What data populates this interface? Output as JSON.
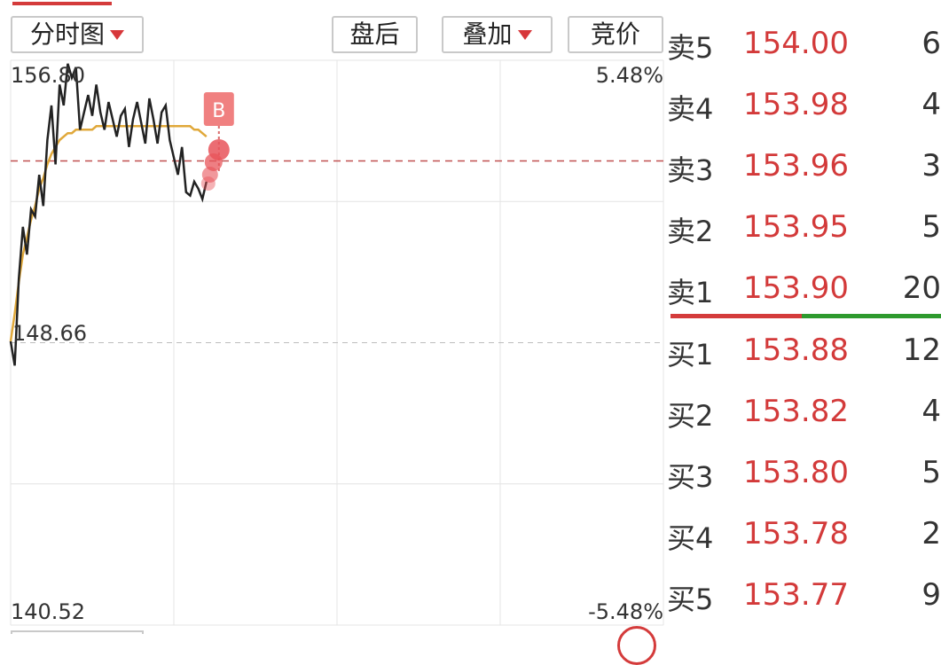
{
  "toolbar": {
    "timeshare_label": "分时图",
    "afterhours_label": "盘后",
    "overlay_label": "叠加",
    "auction_label": "竞价"
  },
  "axis": {
    "price_high": "156.80",
    "price_mid": "148.66",
    "price_low": "140.52",
    "pct_high": "5.48%",
    "pct_low": "-5.48%"
  },
  "marker": {
    "label": "B"
  },
  "colors": {
    "up": "#d33a3a",
    "down": "#2e9a2e",
    "price_line": "#222222",
    "avg_line": "#e0a83a",
    "grid": "#e4e4e4",
    "marker_bg": "#f08080"
  },
  "orderbook": {
    "asks": [
      {
        "side": "卖5",
        "price": "154.00",
        "vol": "6"
      },
      {
        "side": "卖4",
        "price": "153.98",
        "vol": "4"
      },
      {
        "side": "卖3",
        "price": "153.96",
        "vol": "3"
      },
      {
        "side": "卖2",
        "price": "153.95",
        "vol": "5"
      },
      {
        "side": "卖1",
        "price": "153.90",
        "vol": "20"
      }
    ],
    "bids": [
      {
        "side": "买1",
        "price": "153.88",
        "vol": "12"
      },
      {
        "side": "买2",
        "price": "153.82",
        "vol": "4"
      },
      {
        "side": "买3",
        "price": "153.80",
        "vol": "5"
      },
      {
        "side": "买4",
        "price": "153.78",
        "vol": "2"
      },
      {
        "side": "买5",
        "price": "153.77",
        "vol": "9"
      }
    ]
  },
  "chart_data": {
    "type": "line",
    "ylim": [
      140.52,
      156.8
    ],
    "pct_range": [
      -5.48,
      5.48
    ],
    "prev_close": 148.66,
    "reference_price": 153.9,
    "grid": true,
    "series": [
      {
        "values": [
          148.7,
          148.0,
          150.5,
          152.0,
          151.2,
          152.5,
          152.3,
          153.5,
          152.6,
          154.5,
          155.5,
          153.8,
          156.1,
          155.5,
          156.7,
          156.3,
          156.6,
          154.8,
          155.3,
          155.8,
          155.2,
          156.1,
          155.3,
          154.8,
          155.6,
          155.1,
          154.6,
          155.2,
          155.4,
          154.3,
          155.1,
          155.6,
          155.0,
          154.4,
          155.7,
          155.1,
          154.4,
          155.3,
          155.5,
          154.5,
          154.0,
          153.5,
          154.3,
          153.0,
          152.9,
          153.3,
          153.1,
          152.8,
          153.3
        ]
      },
      {
        "values": [
          148.7,
          149.5,
          150.4,
          151.2,
          151.7,
          152.2,
          152.6,
          153.1,
          153.4,
          153.8,
          154.1,
          154.3,
          154.5,
          154.6,
          154.7,
          154.7,
          154.8,
          154.8,
          154.8,
          154.8,
          154.8,
          154.9,
          154.9,
          154.9,
          154.9,
          154.9,
          154.9,
          154.9,
          154.9,
          154.9,
          154.9,
          154.9,
          154.9,
          154.9,
          154.9,
          154.9,
          154.9,
          154.9,
          154.9,
          154.9,
          154.9,
          154.9,
          154.9,
          154.9,
          154.9,
          154.8,
          154.8,
          154.7,
          154.6
        ]
      }
    ],
    "signal": {
      "label": "B"
    }
  }
}
